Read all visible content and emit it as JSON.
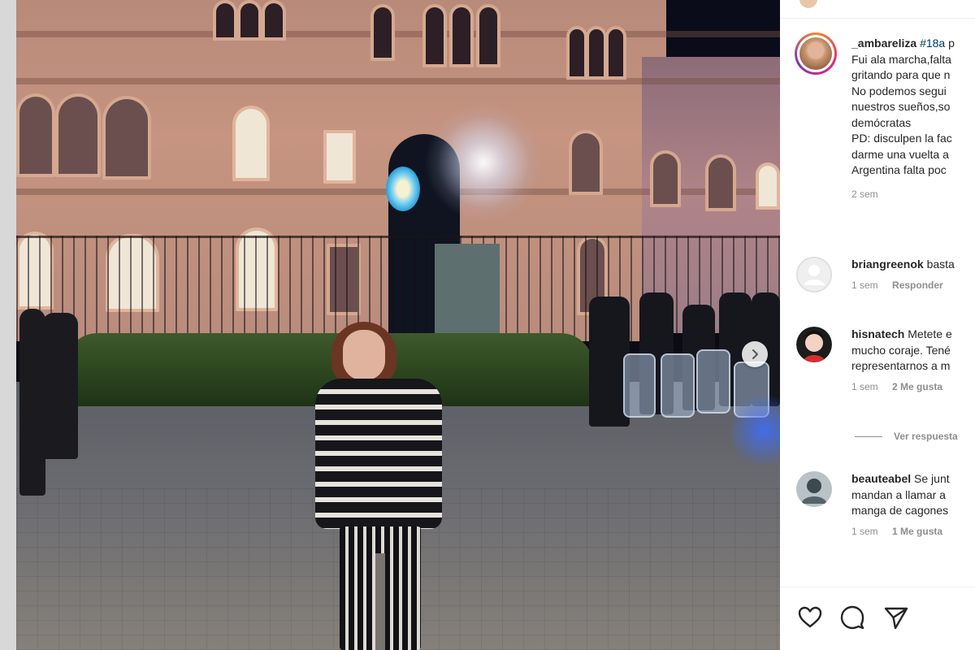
{
  "post": {
    "username": "_ambareliza",
    "hashtag": "#18a",
    "caption_lines": [
      "Fui ala marcha,falta",
      "gritando para que n",
      "No podemos segui",
      "nuestros sueños,so",
      "demócratas",
      "PD: disculpen la fac",
      "darme una vuelta a",
      "Argentina falta poc"
    ],
    "caption_first_suffix": "p",
    "time": "2 sem"
  },
  "comments": [
    {
      "username": "briangreenok",
      "text_lines": [
        "basta"
      ],
      "time": "1 sem",
      "action": "Responder"
    },
    {
      "username": "hisnatech",
      "text_lines": [
        "Metete e",
        "mucho coraje. Tené",
        "representarnos a m"
      ],
      "time": "1 sem",
      "action": "2 Me gusta"
    },
    {
      "username": "beauteabel",
      "text_lines": [
        "Se junt",
        "mandan a llamar a",
        "manga de cagones"
      ],
      "time": "1 sem",
      "action": "1 Me gusta"
    }
  ],
  "view_replies": "Ver respuesta",
  "icons": {
    "like": "heart-icon",
    "comment": "comment-icon",
    "share": "send-icon",
    "next": "chevron-right-icon"
  },
  "colors": {
    "link": "#00376b",
    "muted": "#8e8e8e",
    "text": "#262626"
  }
}
